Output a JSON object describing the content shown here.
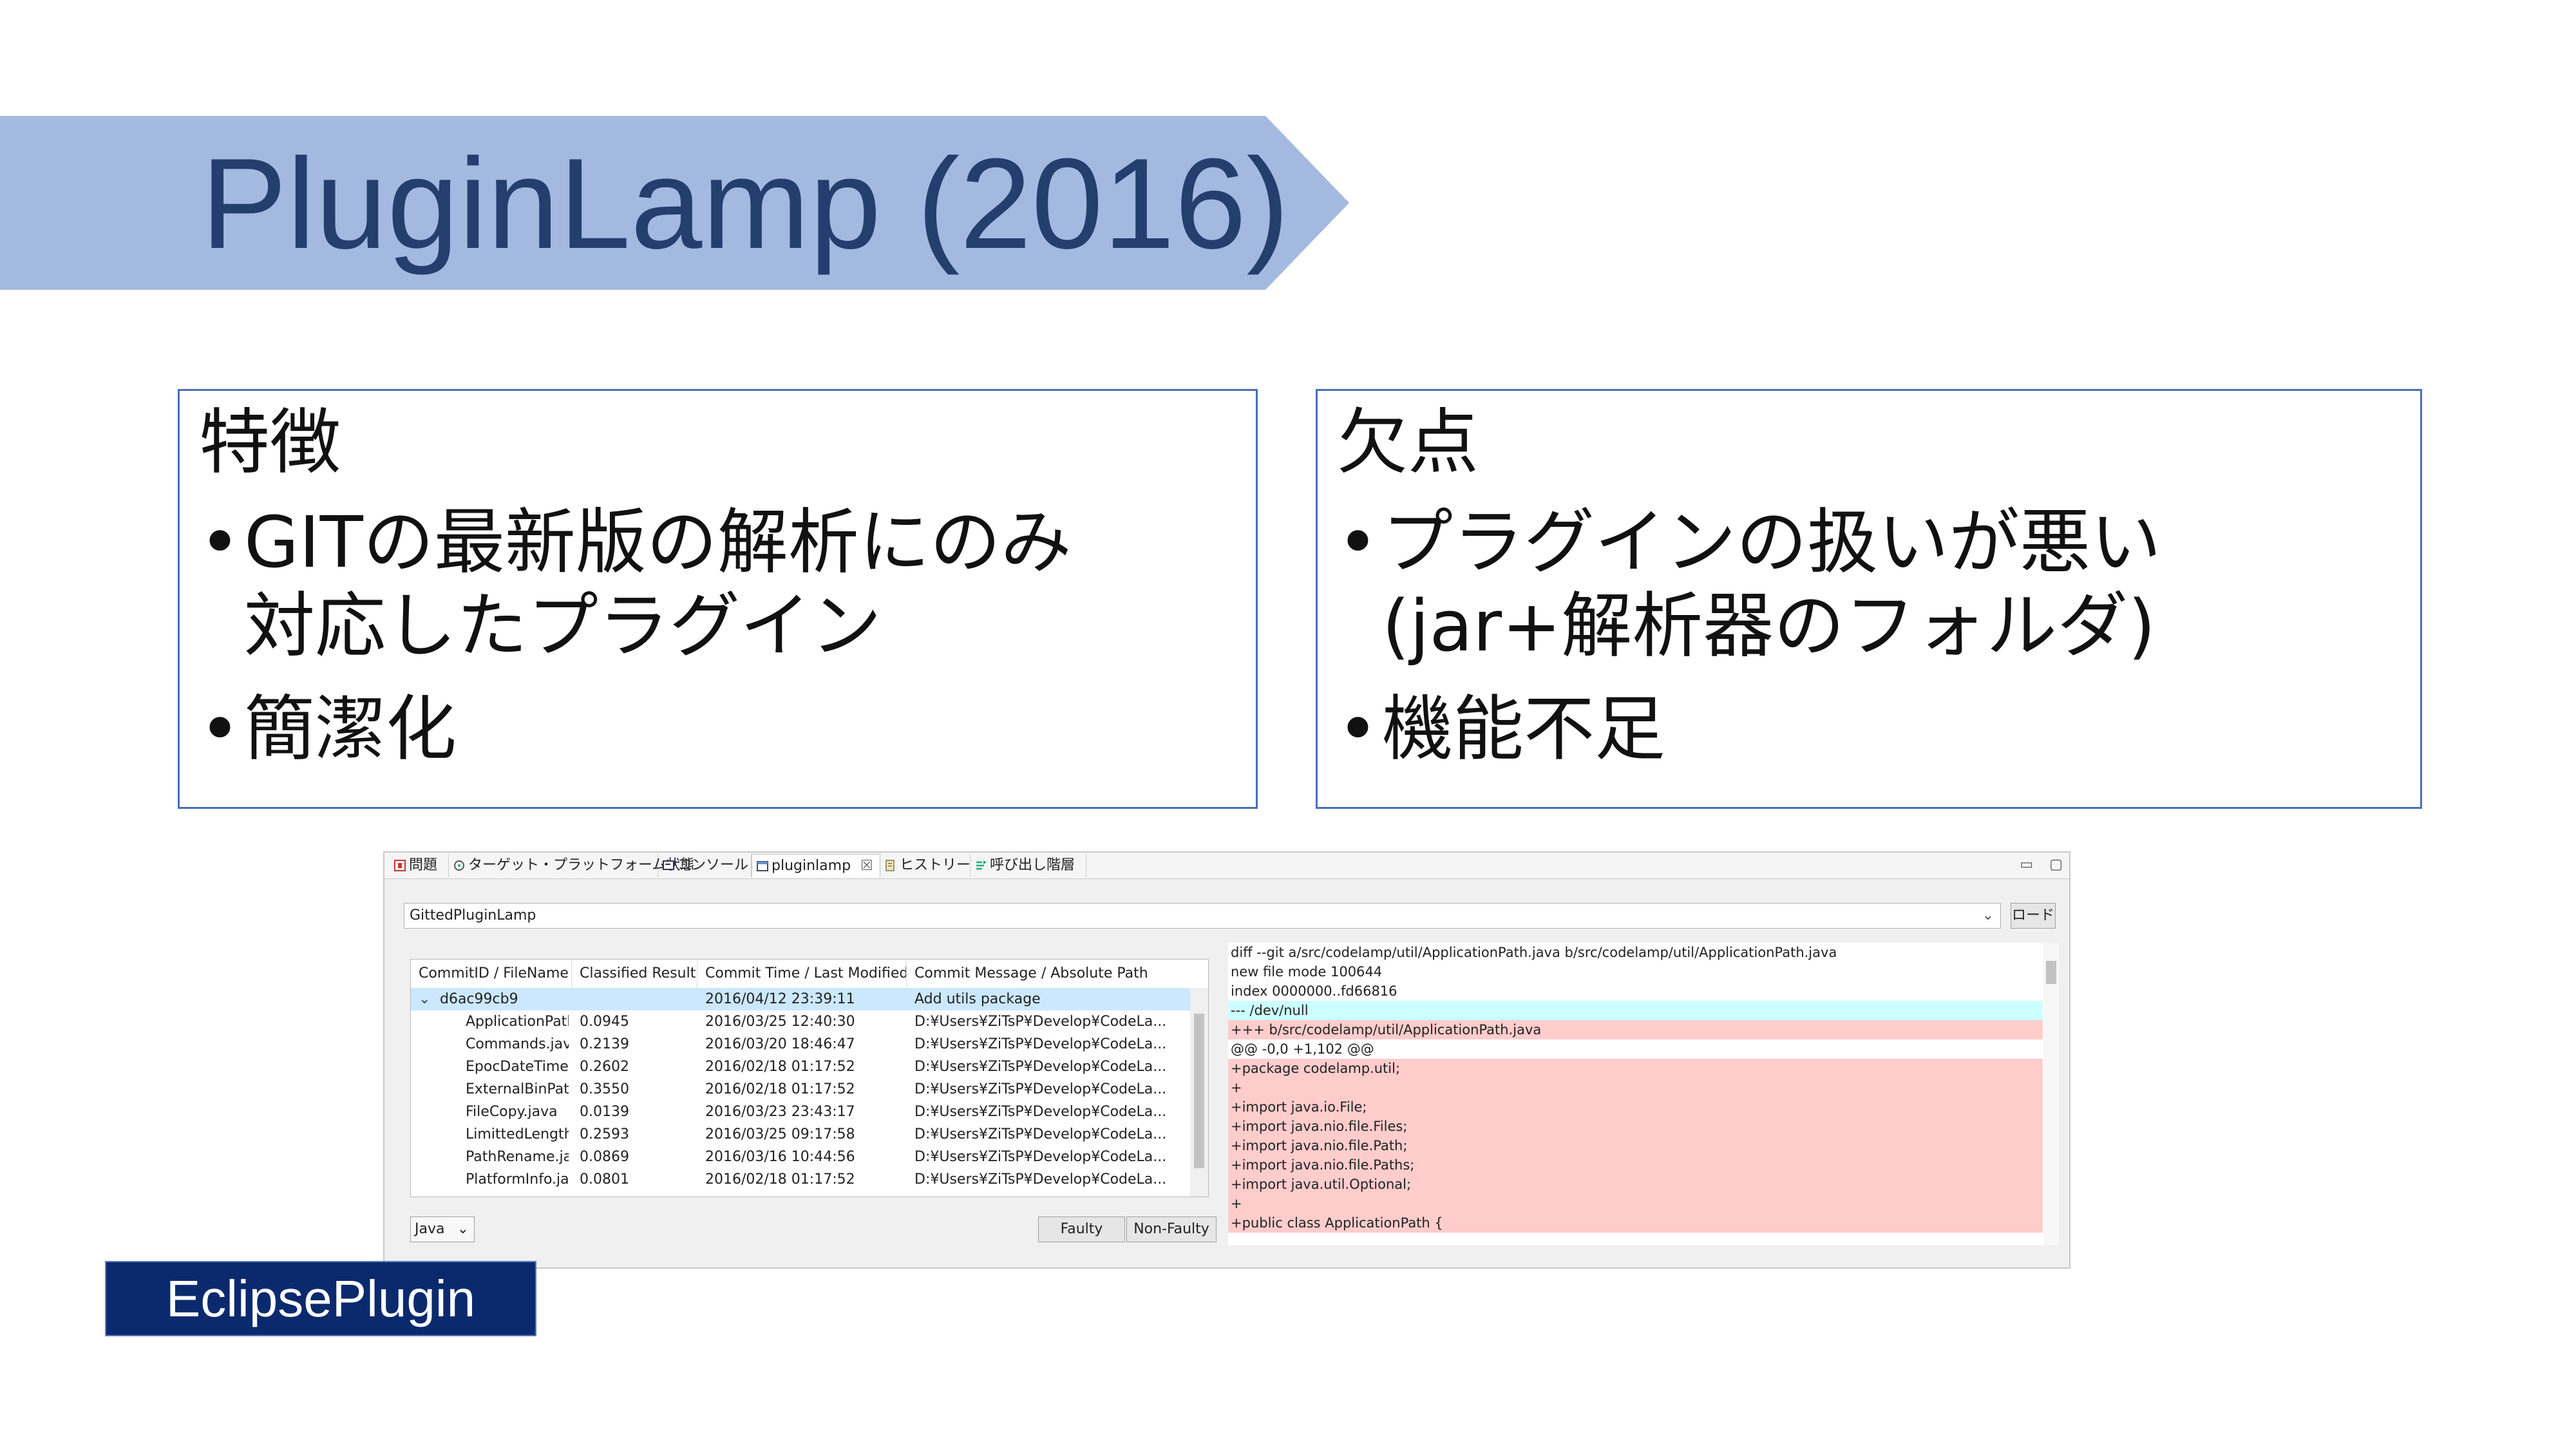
{
  "title": "PluginLamp (2016)",
  "colors": {
    "banner": "#a3b9e0",
    "title": "#243e6e",
    "box_border": "#4a6fb8",
    "tag_bg": "#0b2a6e",
    "diff_added": "#ffcccc",
    "diff_removed": "#ccffff",
    "row_selected": "#cce8ff"
  },
  "features": {
    "heading": "特徴",
    "bullets": [
      {
        "line1": "GITの最新版の解析にのみ",
        "line2": "対応したプラグイン"
      },
      {
        "line1": "簡潔化"
      }
    ]
  },
  "drawbacks": {
    "heading": "欠点",
    "bullets": [
      {
        "line1": "プラグインの扱いが悪い",
        "line2": "(jar+解析器のフォルダ)"
      },
      {
        "line1": "機能不足"
      }
    ]
  },
  "bullet_char": "•",
  "tag": "EclipsePlugin",
  "eclipse": {
    "tabs": [
      {
        "label": "問題",
        "icon": "problems-icon"
      },
      {
        "label": "ターゲット・プラットフォーム状態",
        "icon": "target-platform-icon"
      },
      {
        "label": "コンソール",
        "icon": "console-icon"
      },
      {
        "label": "pluginlamp",
        "icon": "view-icon",
        "active": true
      },
      {
        "label": "ヒストリー",
        "icon": "history-icon"
      },
      {
        "label": "呼び出し階層",
        "icon": "call-hierarchy-icon"
      }
    ],
    "tab_close": "☒",
    "minimize": "▭",
    "maximize": "▢",
    "repo_combo": "GittedPluginLamp",
    "load_button": "ロード",
    "columns": [
      "CommitID / FileName",
      "Classified Result",
      "Commit Time / Last Modified",
      "Commit Message / Absolute Path"
    ],
    "commit_row": {
      "id": "d6ac99cb9",
      "time": "2016/04/12 23:39:11",
      "message": "Add utils package"
    },
    "rows": [
      {
        "file": "ApplicationPath",
        "result": "0.0945",
        "time": "2016/03/25 12:40:30",
        "path": "D:¥Users¥ZiTsP¥Develop¥CodeLa..."
      },
      {
        "file": "Commands.java",
        "result": "0.2139",
        "time": "2016/03/20 18:46:47",
        "path": "D:¥Users¥ZiTsP¥Develop¥CodeLa..."
      },
      {
        "file": "EpocDateTime.ja",
        "result": "0.2602",
        "time": "2016/02/18 01:17:52",
        "path": "D:¥Users¥ZiTsP¥Develop¥CodeLa..."
      },
      {
        "file": "ExternalBinPath",
        "result": "0.3550",
        "time": "2016/02/18 01:17:52",
        "path": "D:¥Users¥ZiTsP¥Develop¥CodeLa..."
      },
      {
        "file": "FileCopy.java",
        "result": "0.0139",
        "time": "2016/03/23 23:43:17",
        "path": "D:¥Users¥ZiTsP¥Develop¥CodeLa..."
      },
      {
        "file": "LimittedLengthS",
        "result": "0.2593",
        "time": "2016/03/25 09:17:58",
        "path": "D:¥Users¥ZiTsP¥Develop¥CodeLa..."
      },
      {
        "file": "PathRename.jav",
        "result": "0.0869",
        "time": "2016/03/16 10:44:56",
        "path": "D:¥Users¥ZiTsP¥Develop¥CodeLa..."
      },
      {
        "file": "PlatformInfo.jav",
        "result": "0.0801",
        "time": "2016/02/18 01:17:52",
        "path": "D:¥Users¥ZiTsP¥Develop¥CodeLa..."
      }
    ],
    "language_select": "Java",
    "faulty_button": "Faulty",
    "nonfaulty_button": "Non-Faulty",
    "diff_lines": [
      {
        "text": "diff --git a/src/codelamp/util/ApplicationPath.java b/src/codelamp/util/ApplicationPath.java",
        "kind": "ctx"
      },
      {
        "text": "new file mode 100644",
        "kind": "ctx"
      },
      {
        "text": "index 0000000..fd66816",
        "kind": "ctx"
      },
      {
        "text": "--- /dev/null",
        "kind": "rem"
      },
      {
        "text": "+++ b/src/codelamp/util/ApplicationPath.java",
        "kind": "add"
      },
      {
        "text": "@@ -0,0 +1,102 @@",
        "kind": "ctx"
      },
      {
        "text": "+package codelamp.util;",
        "kind": "add"
      },
      {
        "text": "+",
        "kind": "add"
      },
      {
        "text": "+import java.io.File;",
        "kind": "add"
      },
      {
        "text": "+import java.nio.file.Files;",
        "kind": "add"
      },
      {
        "text": "+import java.nio.file.Path;",
        "kind": "add"
      },
      {
        "text": "+import java.nio.file.Paths;",
        "kind": "add"
      },
      {
        "text": "+import java.util.Optional;",
        "kind": "add"
      },
      {
        "text": "+",
        "kind": "add"
      },
      {
        "text": "+public class ApplicationPath {",
        "kind": "add"
      }
    ]
  }
}
